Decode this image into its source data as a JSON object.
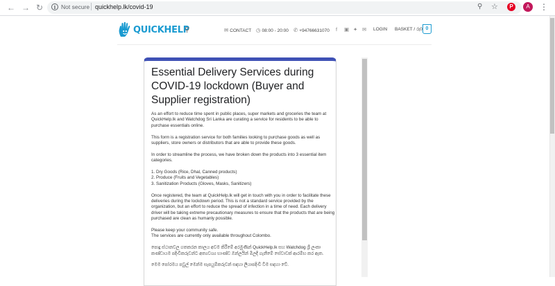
{
  "browser": {
    "back_icon": "arrow-left-icon",
    "forward_icon": "arrow-right-icon",
    "reload_icon": "reload-icon",
    "security_label": "Not secure",
    "url": "quickhelp.lk/covid-19",
    "avatar_letter": "A",
    "extension": "P"
  },
  "header": {
    "logo_text": "QUICKHELP",
    "contact_label": "CONTACT",
    "hours_label": "08:00 - 20:00",
    "phone_label": "+94766631070",
    "login_label": "LOGIN",
    "basket_label": "BASKET / රු0",
    "basket_count": "0",
    "brand_color": "#1b9bd1"
  },
  "form": {
    "accent_color": "#3f51b5",
    "title": "Essential Delivery Services during COVID-19 lockdown (Buyer and Supplier registration)",
    "paragraphs": [
      "As an effort to reduce time spent in public places, super markets and groceries the team at QuickHelp.lk and Watchdog Sri Lanka are curating a service for residents to be able to purchase essentials online.",
      "This form is a registration service for both families looking to purchase goods as well as suppliers, store owners or distributors that are able to provide these goods.",
      "In order to streamline the process, we have broken down the products into 3 essential item categories.",
      "1. Dry Goods (Rice, Dhal, Canned products)",
      "2. Produce (Fruits and Vegetables)",
      "3. Sanitization Products (Gloves, Masks, Sanitizers)",
      "Once registered, the team at QuickHelp.lk will get in touch with you in order to facilitate these deliveries during the lockdown period. This is not a standard service provided by the organization, but an effort to reduce the spread of infection in a time of need. Each delivery driver will be taking extreme precautionary measures to ensure that the products that are being purchased are clean as humanly possible.",
      "Please keep your community safe.",
      "The services are currently only available throughout Colombo.",
      "පොදු ස්ථානවල ගතකරන කාලය අවම කිරීමේ අරමුණින් QuickHelp.lk සහ Watchdog ශ්‍රී ලංකා කණ්ඩායම පදිංචිකරුවන්ට අත්‍යවශ්‍ය භාණ්ඩ ඔන්ලයින් මිලදී ගැනීමේ සේවාවක් ආරම්භ කර ඇත.",
      "මෙම පෝරමය පවුල් මෙන්ම සැපයුම්කරුවන් සඳහා ලියාපදිංචි වීම සඳහා වේ."
    ]
  }
}
